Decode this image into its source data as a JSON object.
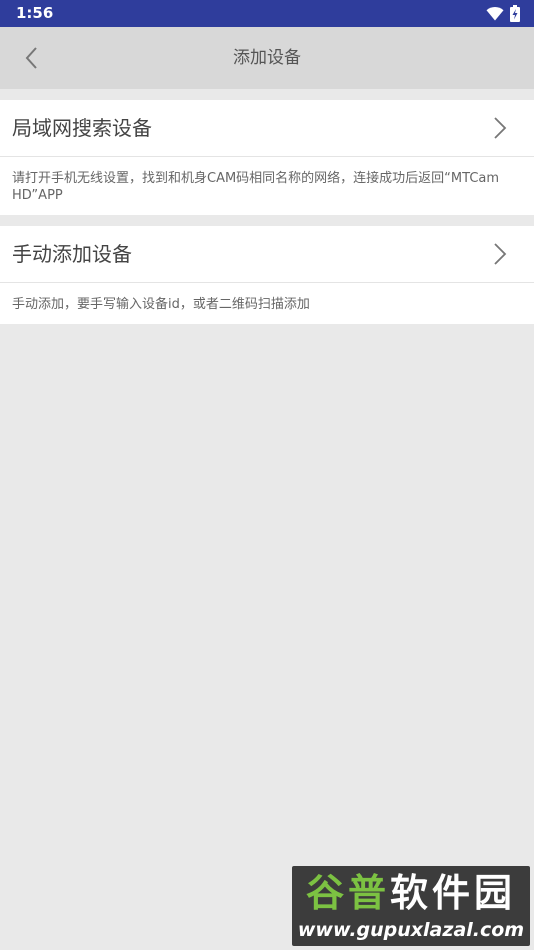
{
  "status_bar": {
    "time": "1:56"
  },
  "header": {
    "title": "添加设备"
  },
  "options": [
    {
      "label": "局域网搜索设备",
      "description": "请打开手机无线设置，找到和机身CAM码相同名称的网络，连接成功后返回“MTCam HD”APP"
    },
    {
      "label": "手动添加设备",
      "description": "手动添加，要手写输入设备id，或者二维码扫描添加"
    }
  ],
  "watermark": {
    "brand_part1": "谷普",
    "brand_part2": "软件园",
    "url": "www.gupuxlazal.com"
  },
  "colors": {
    "status_bar": "#2f3d9c",
    "title_bar": "#d8d8d8",
    "background": "#e9e9e9",
    "card": "#ffffff"
  }
}
